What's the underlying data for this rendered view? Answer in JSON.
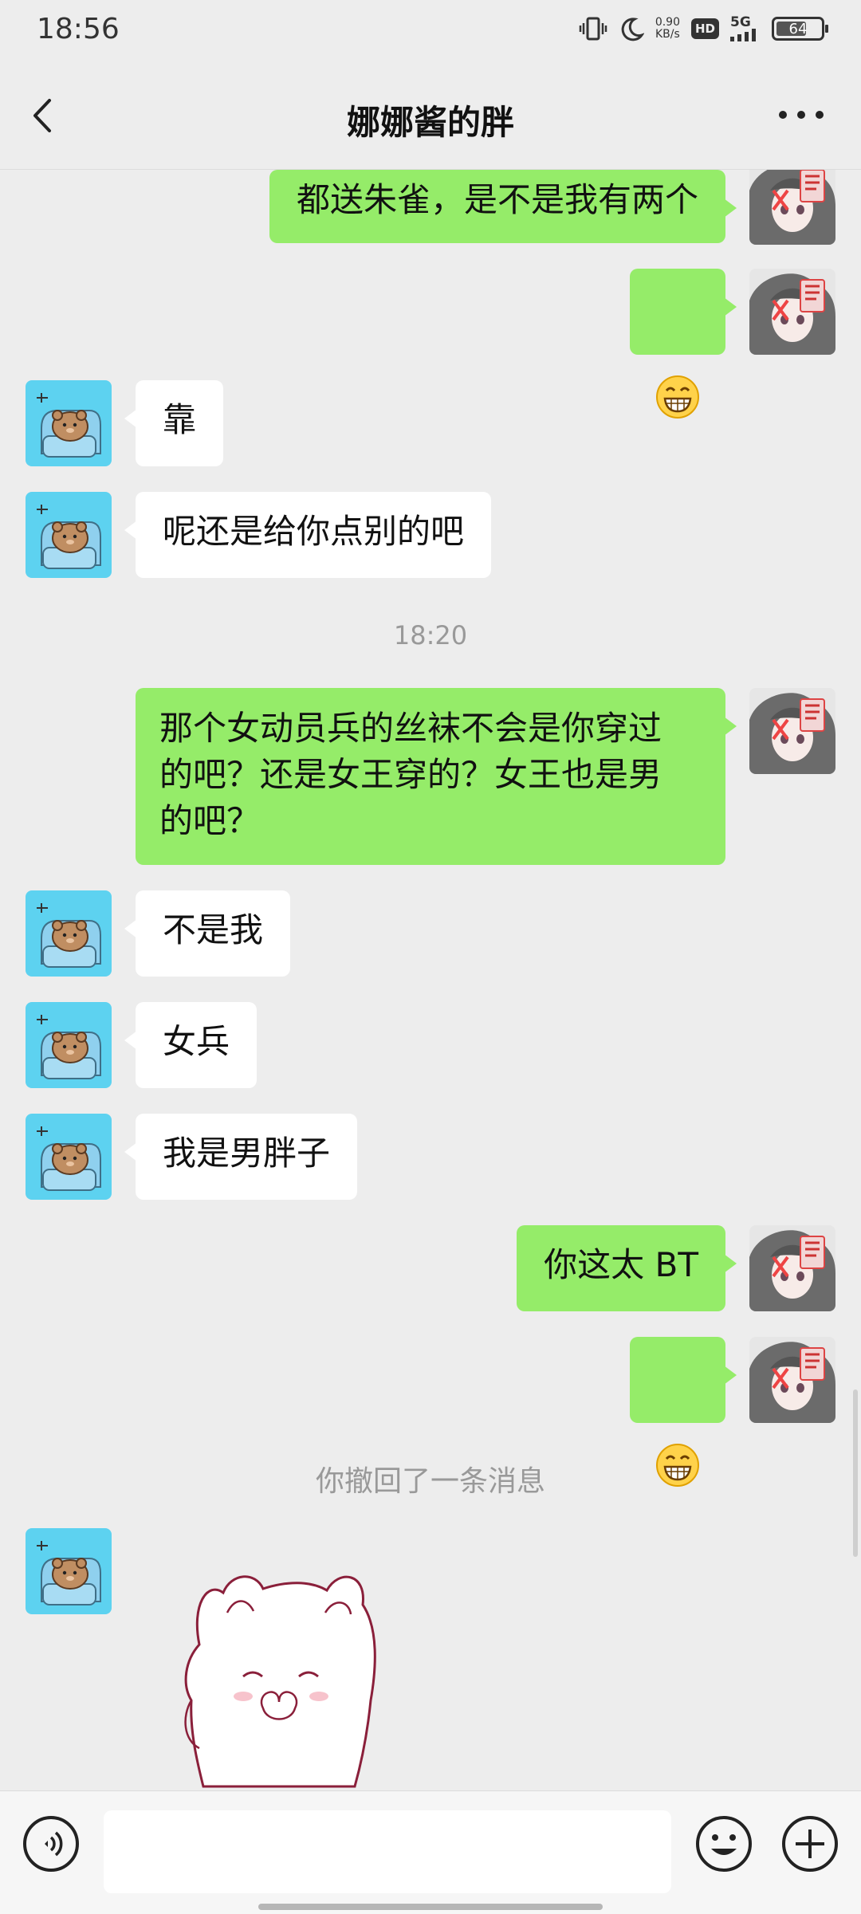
{
  "status_bar": {
    "time": "18:56",
    "net_speed_value": "0.90",
    "net_speed_unit": "KB/s",
    "hd_label": "HD",
    "network_label": "5G",
    "battery": "64"
  },
  "header": {
    "title": "娜娜酱的胖"
  },
  "messages": [
    {
      "side": "me",
      "text": "都送朱雀，是不是我有两个"
    },
    {
      "side": "me",
      "emoji": "grin-emoji"
    },
    {
      "side": "them",
      "text": "靠"
    },
    {
      "side": "them",
      "text": "呢还是给你点别的吧"
    },
    {
      "timestamp": "18:20"
    },
    {
      "side": "me",
      "text": "那个女动员兵的丝袜不会是你穿过\n的吧？还是女王穿的？女王也是男\n的吧？"
    },
    {
      "side": "them",
      "text": "不是我"
    },
    {
      "side": "them",
      "text": "女兵"
    },
    {
      "side": "them",
      "text": "我是男胖子"
    },
    {
      "side": "me",
      "text": "你这太 BT"
    },
    {
      "side": "me",
      "emoji": "grin-emoji"
    },
    {
      "system": "你撤回了一条消息"
    },
    {
      "side": "them",
      "sticker": "white-cat-sticker"
    }
  ],
  "input": {
    "value": ""
  },
  "colors": {
    "background": "#ededed",
    "my_bubble": "#95ec69",
    "their_bubble": "#ffffff"
  }
}
